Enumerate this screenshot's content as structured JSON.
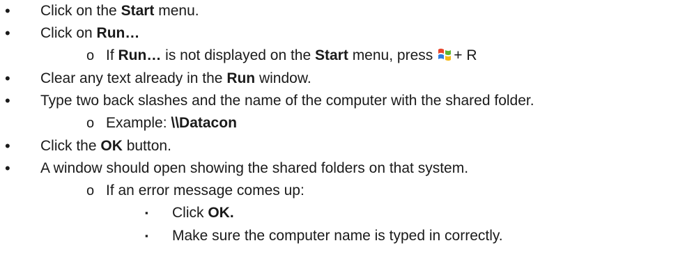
{
  "bullets": {
    "level1": "•",
    "level2": "o",
    "level3": "▪"
  },
  "items": [
    {
      "pre": "Click on the ",
      "bold": "Start",
      "post": " menu."
    },
    {
      "pre": "Click on ",
      "bold": "Run…",
      "post": ""
    },
    {
      "pre": "If ",
      "bold": "Run…",
      "mid": " is not displayed on the ",
      "bold2": "Start",
      "post": " menu, press",
      "key": "+ R"
    },
    {
      "pre": "Clear any text already in the ",
      "bold": "Run",
      "post": " window."
    },
    {
      "pre": "Type two back slashes and the name of the computer with the shared folder.",
      "bold": "",
      "post": ""
    },
    {
      "pre": "Example: ",
      "bold": "\\\\Datacon",
      "post": ""
    },
    {
      "pre": "Click the ",
      "bold": "OK",
      "post": " button."
    },
    {
      "pre": "A window should open showing the shared folders on that system.",
      "bold": "",
      "post": ""
    },
    {
      "pre": "If an error message comes up:",
      "bold": "",
      "post": ""
    },
    {
      "pre": "Click ",
      "bold": "OK.",
      "post": ""
    },
    {
      "pre": "Make sure the computer name is typed in correctly.",
      "bold": "",
      "post": ""
    }
  ],
  "icons": {
    "windows_key": "windows-logo-icon"
  },
  "colors": {
    "text": "#1a1a1a",
    "logo_red": "#e8452c",
    "logo_green": "#5cb531",
    "logo_blue": "#2f7ce0",
    "logo_yellow": "#f5b915"
  }
}
